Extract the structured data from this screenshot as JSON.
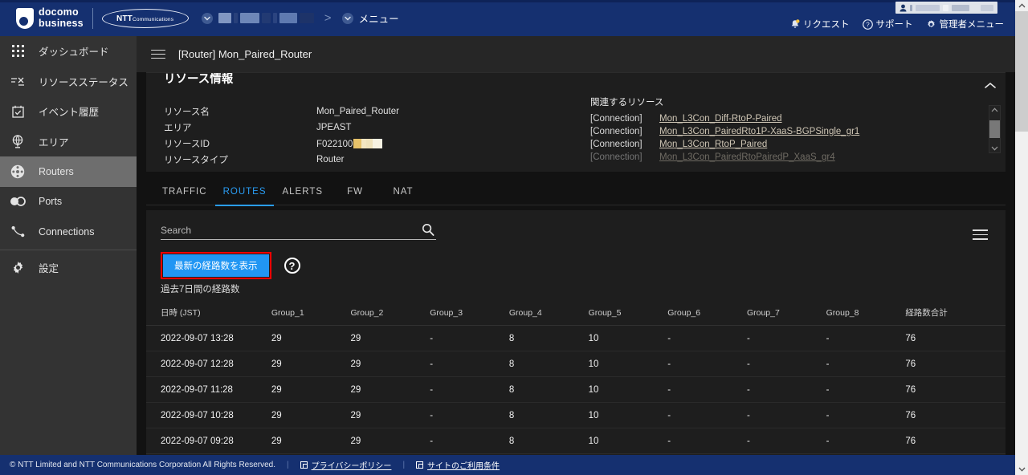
{
  "topbar": {
    "brand_primary_line1": "docomo",
    "brand_primary_line2": "business",
    "brand_secondary": "NTT",
    "brand_secondary_small": "Communications",
    "org_selector_redacted": "",
    "breadcrumb_separator": ">",
    "menu_label": "メニュー",
    "user_pill_redacted": "",
    "links": [
      {
        "label": "リクエスト",
        "icon": "bell-icon"
      },
      {
        "label": "サポート",
        "icon": "question-circle-icon"
      },
      {
        "label": "管理者メニュー",
        "icon": "gear-icon"
      }
    ]
  },
  "sidebar": {
    "items": [
      {
        "label": "ダッシュボード",
        "icon": "grid-icon",
        "active": false
      },
      {
        "label": "リソースステータス",
        "icon": "resource-status-icon",
        "active": false
      },
      {
        "label": "イベント履歴",
        "icon": "calendar-check-icon",
        "active": false
      },
      {
        "label": "エリア",
        "icon": "globe-icon",
        "active": false
      },
      {
        "label": "Routers",
        "icon": "router-icon",
        "active": true
      },
      {
        "label": "Ports",
        "icon": "ports-icon",
        "active": false
      },
      {
        "label": "Connections",
        "icon": "connection-icon",
        "active": false
      },
      {
        "label": "設定",
        "icon": "gear-icon",
        "active": false
      }
    ]
  },
  "page": {
    "title": "[Router] Mon_Paired_Router",
    "menu_icon": "hamburger-icon"
  },
  "resource_panel": {
    "title": "リソース情報",
    "collapse_icon": "chevron-up-icon",
    "fields": [
      {
        "label": "リソース名",
        "value": "Mon_Paired_Router"
      },
      {
        "label": "エリア",
        "value": "JPEAST"
      },
      {
        "label": "リソースID",
        "value": "F022100",
        "redacted": true
      },
      {
        "label": "リソースタイプ",
        "value": "Router"
      }
    ],
    "related": {
      "title": "関連するリソース",
      "items": [
        {
          "kind": "[Connection]",
          "name": "Mon_L3Con_Diff-RtoP-Paired"
        },
        {
          "kind": "[Connection]",
          "name": "Mon_L3Con_PairedRto1P-XaaS-BGPSingle_gr1"
        },
        {
          "kind": "[Connection]",
          "name": "Mon_L3Con_RtoP_Paired"
        },
        {
          "kind": "[Connection]",
          "name": "Mon_L3Con_PairedRtoPairedP_XaaS_gr4"
        }
      ]
    }
  },
  "tabs": [
    {
      "label": "TRAFFIC",
      "active": false
    },
    {
      "label": "ROUTES",
      "active": true
    },
    {
      "label": "ALERTS",
      "active": false
    },
    {
      "label": "FW",
      "active": false
    },
    {
      "label": "NAT",
      "active": false
    }
  ],
  "search": {
    "placeholder": "Search",
    "value": "",
    "icon": "search-icon"
  },
  "toolbar": {
    "table_menu_icon": "hamburger-menu-icon",
    "refresh_button_label": "最新の経路数を表示",
    "help_icon_label": "?",
    "accent_color": "#2196f3",
    "annotation_color": "#ff0000"
  },
  "table": {
    "caption": "過去7日間の経路数",
    "columns": [
      "日時 (JST)",
      "Group_1",
      "Group_2",
      "Group_3",
      "Group_4",
      "Group_5",
      "Group_6",
      "Group_7",
      "Group_8",
      "経路数合計"
    ],
    "rows": [
      [
        "2022-09-07 13:28",
        "29",
        "29",
        "-",
        "8",
        "10",
        "-",
        "-",
        "-",
        "76"
      ],
      [
        "2022-09-07 12:28",
        "29",
        "29",
        "-",
        "8",
        "10",
        "-",
        "-",
        "-",
        "76"
      ],
      [
        "2022-09-07 11:28",
        "29",
        "29",
        "-",
        "8",
        "10",
        "-",
        "-",
        "-",
        "76"
      ],
      [
        "2022-09-07 10:28",
        "29",
        "29",
        "-",
        "8",
        "10",
        "-",
        "-",
        "-",
        "76"
      ],
      [
        "2022-09-07 09:28",
        "29",
        "29",
        "-",
        "8",
        "10",
        "-",
        "-",
        "-",
        "76"
      ]
    ]
  },
  "footer": {
    "copyright": "© NTT Limited and NTT Communications Corporation All Rights Reserved.",
    "links": [
      {
        "label": "プライバシーポリシー"
      },
      {
        "label": "サイトのご利用条件"
      }
    ]
  }
}
